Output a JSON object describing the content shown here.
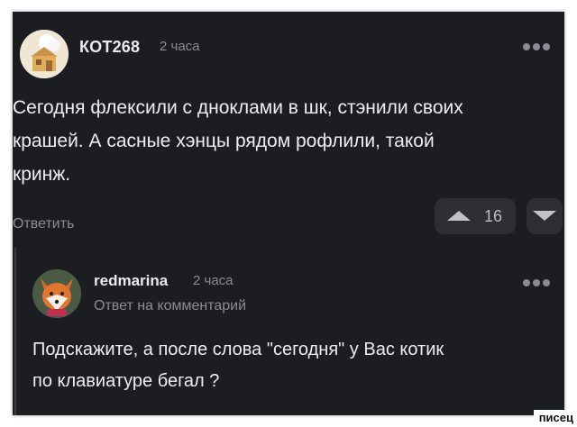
{
  "main_comment": {
    "author": "КОТ268",
    "time": "2 часа",
    "text_lines": [
      "Сегодня флексили с дноклами в шк, стэнили своих",
      "крашей. А сасные хэнцы рядом рофлили, такой",
      "кринж."
    ],
    "reply_label": "Ответить",
    "vote_count": "16"
  },
  "reply_comment": {
    "author": "redmarina",
    "time": "2 часа",
    "reply_to_label": "Ответ на комментарий",
    "text_lines": [
      "Подскажите, а после слова \"сегодня\" у Вас котик",
      "по клавиатуре бегал ?"
    ]
  },
  "icons": {
    "more": "more-dots-icon",
    "upvote": "upvote-triangle-icon",
    "downvote": "downvote-triangle-icon"
  },
  "colors": {
    "background": "#1c1d21",
    "text": "#eceef2",
    "muted": "#8b8d94",
    "button": "#2d2f35"
  },
  "watermark": "писец"
}
